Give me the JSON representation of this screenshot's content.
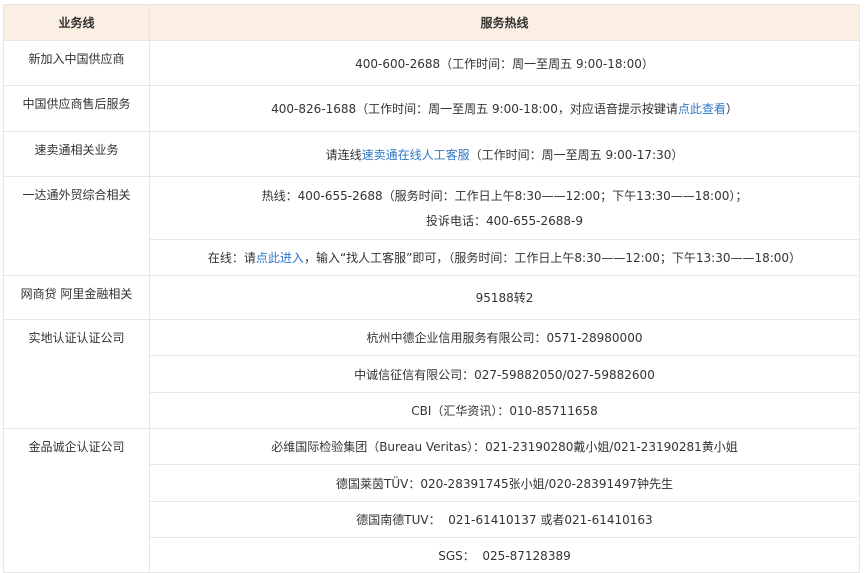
{
  "header": {
    "col1": "业务线",
    "col2": "服务热线"
  },
  "rows": {
    "supplier": {
      "label": "新加入中国供应商",
      "text": "400-600-2688（工作时间：周一至周五 9:00-18:00）"
    },
    "aftersales": {
      "label": "中国供应商售后服务",
      "text_pre": "400-826-1688（工作时间：周一至周五 9:00-18:00，对应语音提示按键请",
      "link": "点此查看",
      "text_post": "）"
    },
    "sumaitong": {
      "label": "速卖通相关业务",
      "text_pre": "请连线",
      "link": "速卖通在线人工客服",
      "text_post": "（工作时间：周一至周五 9:00-17:30）"
    },
    "yidatong": {
      "label": "一达通外贸综合相关",
      "hotline": "热线：400-655-2688（服务时间：工作日上午8:30——12:00；下午13:30——18:00）；",
      "complaint": "投诉电话：400-655-2688-9",
      "online_pre": "在线：请",
      "online_link": "点此进入",
      "online_post": "，输入“找人工客服”即可，（服务时间：工作日上午8:30——12:00；下午13:30——18:00）"
    },
    "finance": {
      "label": "网商贷 阿里金融相关",
      "text": "95188转2"
    },
    "onsite": {
      "label": "实地认证认证公司",
      "items": [
        "杭州中德企业信用服务有限公司：0571-28980000",
        "中诚信征信有限公司：027-59882050/027-59882600",
        "CBI（汇华资讯）：010-85711658"
      ]
    },
    "gold": {
      "label": "金品诚企认证公司",
      "items": [
        "必维国际检验集团（Bureau Veritas）：021-23190280戴小姐/021-23190281黄小姐",
        "德国莱茵TÜV：020-28391745张小姐/020-28391497钟先生",
        "德国南德TUV：  021-61410137 或者021-61410163",
        "SGS：  025-87128389"
      ]
    }
  }
}
